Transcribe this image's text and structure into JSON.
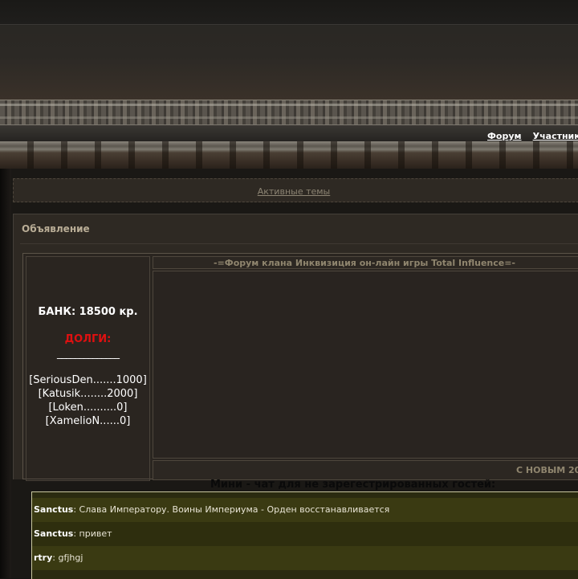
{
  "nav": {
    "links": [
      "Форум",
      "Участники"
    ]
  },
  "active_topics": {
    "label": "Активные темы"
  },
  "announcement": {
    "title": "Объявление",
    "headline": "-=Форум клана Инквизиция он-лайн игры Total Influence=-",
    "new_year": "С НОВЫМ 20",
    "bank": {
      "title": "БАНК: 18500 кр.",
      "debts_title": "ДОЛГИ:",
      "separator": "______________",
      "debts": [
        "[SeriousDen.......1000]",
        "[Katusik........2000]",
        "[Loken..........0]",
        "[XamelioN......0]"
      ]
    }
  },
  "chat": {
    "title": "Мини - чат для не зарегестрированных гостей:",
    "messages": [
      {
        "author": "Sanctus",
        "text": ": Слава Императору. Воины Империума - Орден восстанавливается"
      },
      {
        "author": "Sanctus",
        "text": ": привет"
      },
      {
        "author": "rtry",
        "text": ": gfjhgj"
      }
    ]
  },
  "colors": {
    "debt_red": "#e01010",
    "link_muted": "#8c8473",
    "chat_bg": "#3a3a12"
  }
}
